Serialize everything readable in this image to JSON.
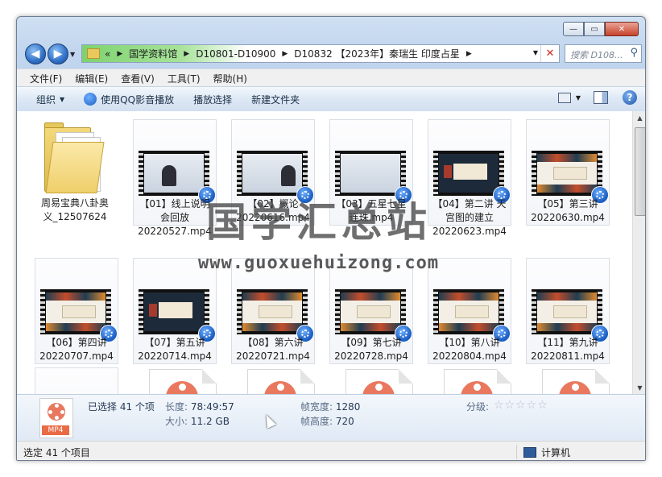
{
  "window": {
    "controls": {
      "minimize": "—",
      "maximize": "▭",
      "close": "✕"
    }
  },
  "nav": {
    "back_glyph": "◀",
    "forward_glyph": "▶",
    "breadcrumbs": [
      "«",
      "国学资料馆",
      "D10801-D10900",
      "D10832 【2023年】秦瑞生 印度占星"
    ],
    "search_placeholder": "搜索 D108...",
    "icons": [
      "back-icon",
      "forward-icon",
      "folder-icon",
      "dropdown-icon",
      "close-icon",
      "search-icon"
    ]
  },
  "menu": [
    "文件(F)",
    "编辑(E)",
    "查看(V)",
    "工具(T)",
    "帮助(H)"
  ],
  "toolbar": {
    "organize": "组织",
    "play_qq": "使用QQ影音播放",
    "play_selected": "播放选择",
    "new_folder": "新建文件夹",
    "help": "?"
  },
  "files": [
    {
      "name_line1": "周易宝典八卦奥",
      "name_line2": "义_12507624",
      "type": "folder"
    },
    {
      "name_line1": "【01】线上说明",
      "name_line2": "会回放",
      "name_line3": "20220527.mp4",
      "type": "video-board"
    },
    {
      "name_line1": "【02】概论",
      "name_line2": "20220616.mp4",
      "type": "video-board"
    },
    {
      "name_line1": "【03】五星七星",
      "name_line2": "连珠.mp4",
      "type": "video-board"
    },
    {
      "name_line1": "【04】第二讲 天",
      "name_line2": "宫图的建立",
      "name_line3": "20220623.mp4",
      "type": "video-cover"
    },
    {
      "name_line1": "【05】第三讲",
      "name_line2": "20220630.mp4",
      "type": "video-slide"
    },
    {
      "name_line1": "【06】第四讲",
      "name_line2": "20220707.mp4",
      "type": "video-slide"
    },
    {
      "name_line1": "【07】第五讲",
      "name_line2": "20220714.mp4",
      "type": "video-cover"
    },
    {
      "name_line1": "【08】第六讲",
      "name_line2": "20220721.mp4",
      "type": "video-slide"
    },
    {
      "name_line1": "【09】第七讲",
      "name_line2": "20220728.mp4",
      "type": "video-slide"
    },
    {
      "name_line1": "【10】第八讲",
      "name_line2": "20220804.mp4",
      "type": "video-slide"
    },
    {
      "name_line1": "【11】第九讲",
      "name_line2": "20220811.mp4",
      "type": "video-slide"
    }
  ],
  "details": {
    "selected": "已选择 41 个项",
    "length_label": "长度:",
    "length_value": "78:49:57",
    "size_label": "大小:",
    "size_value": "11.2 GB",
    "frame_width_label": "帧宽度:",
    "frame_width_value": "1280",
    "frame_height_label": "帧高度:",
    "frame_height_value": "720",
    "rating_label": "分级:",
    "stars": "☆☆☆☆☆",
    "file_tag": "MP4"
  },
  "status": {
    "left": "选定 41 个项目",
    "right": "计算机"
  },
  "watermark": {
    "cn": "国学汇总站",
    "url": "www.guoxuehuizong.com"
  },
  "colors": {
    "chrome": "#bcd2ec",
    "address_highlight": "#7ed36e",
    "close_button": "#c7432b",
    "video_badge": "#1c5fc4",
    "mp4_reel": "#e9785e"
  }
}
